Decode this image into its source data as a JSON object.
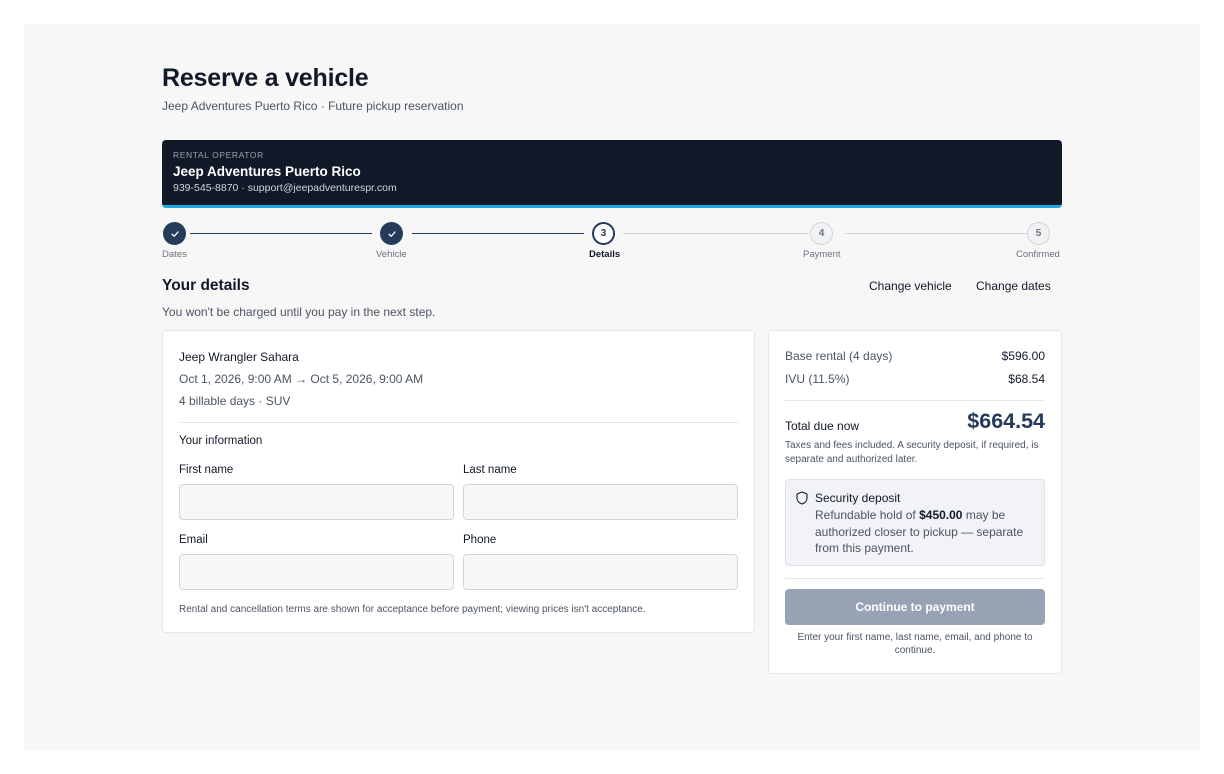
{
  "header": {
    "title": "Reserve a vehicle",
    "subtitle": "Jeep Adventures Puerto Rico · Future pickup reservation"
  },
  "operator": {
    "kicker": "RENTAL OPERATOR",
    "name": "Jeep Adventures Puerto Rico",
    "contact": "939-545-8870 · support@jeepadventurespr.com"
  },
  "steps": [
    {
      "label": "Dates",
      "number": "1",
      "state": "done"
    },
    {
      "label": "Vehicle",
      "number": "2",
      "state": "done"
    },
    {
      "label": "Details",
      "number": "3",
      "state": "current"
    },
    {
      "label": "Payment",
      "number": "4",
      "state": "todo"
    },
    {
      "label": "Confirmed",
      "number": "5",
      "state": "todo"
    }
  ],
  "details": {
    "heading": "Your details",
    "note": "You won't be charged until you pay in the next step.",
    "change_vehicle": "Change vehicle",
    "change_dates": "Change dates"
  },
  "vehicle": {
    "name": "Jeep Wrangler Sahara",
    "dates": "Oct 1, 2026, 9:00 AM → Oct 5, 2026, 9:00 AM",
    "summary": "4 billable days · SUV"
  },
  "form": {
    "heading": "Your information",
    "first_name": {
      "label": "First name",
      "value": ""
    },
    "last_name": {
      "label": "Last name",
      "value": ""
    },
    "email": {
      "label": "Email",
      "value": ""
    },
    "phone": {
      "label": "Phone",
      "value": ""
    },
    "terms": "Rental and cancellation terms are shown for acceptance before payment; viewing prices isn't acceptance."
  },
  "summary": {
    "base_label": "Base rental (4 days)",
    "base_value": "$596.00",
    "tax_label": "IVU (11.5%)",
    "tax_value": "$68.54",
    "total_label": "Total due now",
    "total_value": "$664.54",
    "tax_note": "Taxes and fees included. A security deposit, if required, is separate and authorized later.",
    "deposit_title": "Security deposit",
    "deposit_pre": "Refundable hold of ",
    "deposit_amount": "$450.00",
    "deposit_post": " may be authorized closer to pickup — separate from this payment.",
    "continue_label": "Continue to payment",
    "continue_note": "Enter your first name, last name, email, and phone to continue."
  },
  "colors": {
    "navy": "#243b5a",
    "operator_bg": "#111827",
    "accent": "#1ea7e1",
    "button_disabled": "#97a3b4"
  },
  "icons": {
    "check": "check-icon",
    "shield": "shield-icon"
  }
}
